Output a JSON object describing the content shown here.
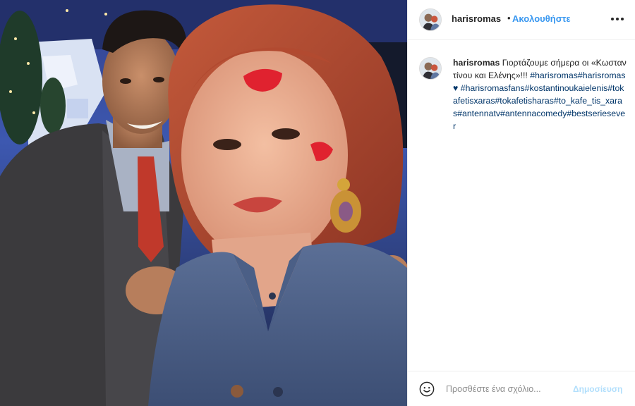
{
  "post": {
    "username": "harisromas",
    "dot": "•",
    "follow_label": "Ακολουθήστε",
    "more_icon": "more-horizontal-icon"
  },
  "caption": {
    "username": "harisromas",
    "text": "Γιορτάζουμε σήμερα οι «Κωσταντίνου και Ελένης»!!!",
    "hashtags_line1": "#harisromas#harisromas",
    "heart": "♥",
    "hashtags_line2": "#harisromasfans#kostantinoukaielenis#tokafetisxaras#tokafetisharas#to_kafe_tis_xaras#antennatv#antennacomedy#bestseriesever"
  },
  "comment_box": {
    "placeholder": "Προσθέστε ένα σχόλιο...",
    "publish_label": "Δημοσίευση",
    "emoji_icon": "smiley-icon"
  },
  "colors": {
    "link": "#3897f0",
    "hashtag": "#003569",
    "publish_disabled": "#b2dffc",
    "border": "#efefef"
  }
}
